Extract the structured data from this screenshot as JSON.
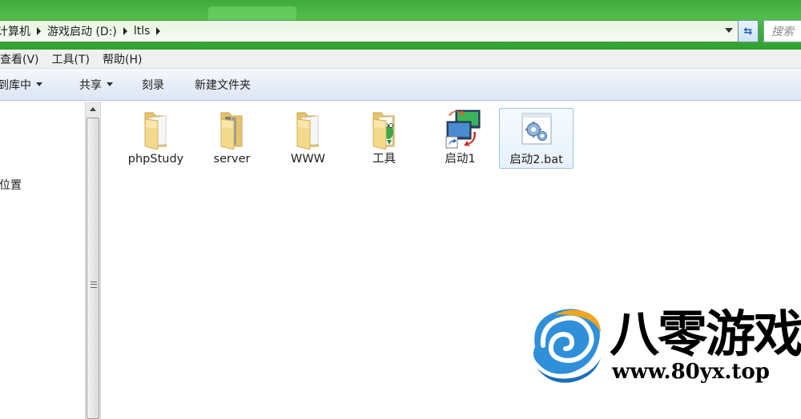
{
  "address": {
    "crumbs": [
      "计算机",
      "游戏启动 (D:)",
      "ltls"
    ],
    "refresh_icon": "refresh-icon"
  },
  "search": {
    "placeholder": "搜索"
  },
  "menu": {
    "items": [
      "查看(V)",
      "工具(T)",
      "帮助(H)"
    ]
  },
  "commands": {
    "include_library": "到库中",
    "share": "共享",
    "burn": "刻录",
    "new_folder": "新建文件夹"
  },
  "nav": {
    "partial_item": "位置"
  },
  "files": [
    {
      "name": "phpStudy",
      "icon": "folder-icon"
    },
    {
      "name": "server",
      "icon": "folder-icon"
    },
    {
      "name": "WWW",
      "icon": "folder-icon"
    },
    {
      "name": "工具",
      "icon": "folder-with-frog-icon"
    },
    {
      "name": "启动1",
      "icon": "shortcut-monitors-icon"
    },
    {
      "name": "启动2.bat",
      "icon": "gear-batch-icon",
      "selected": true
    }
  ],
  "watermark": {
    "title": "八零游戏",
    "url": "www.80yx.top"
  },
  "colors": {
    "titlebar": "#3fb03a",
    "selection_border": "#99c4e8",
    "command_bar": "#e3ebf6"
  }
}
